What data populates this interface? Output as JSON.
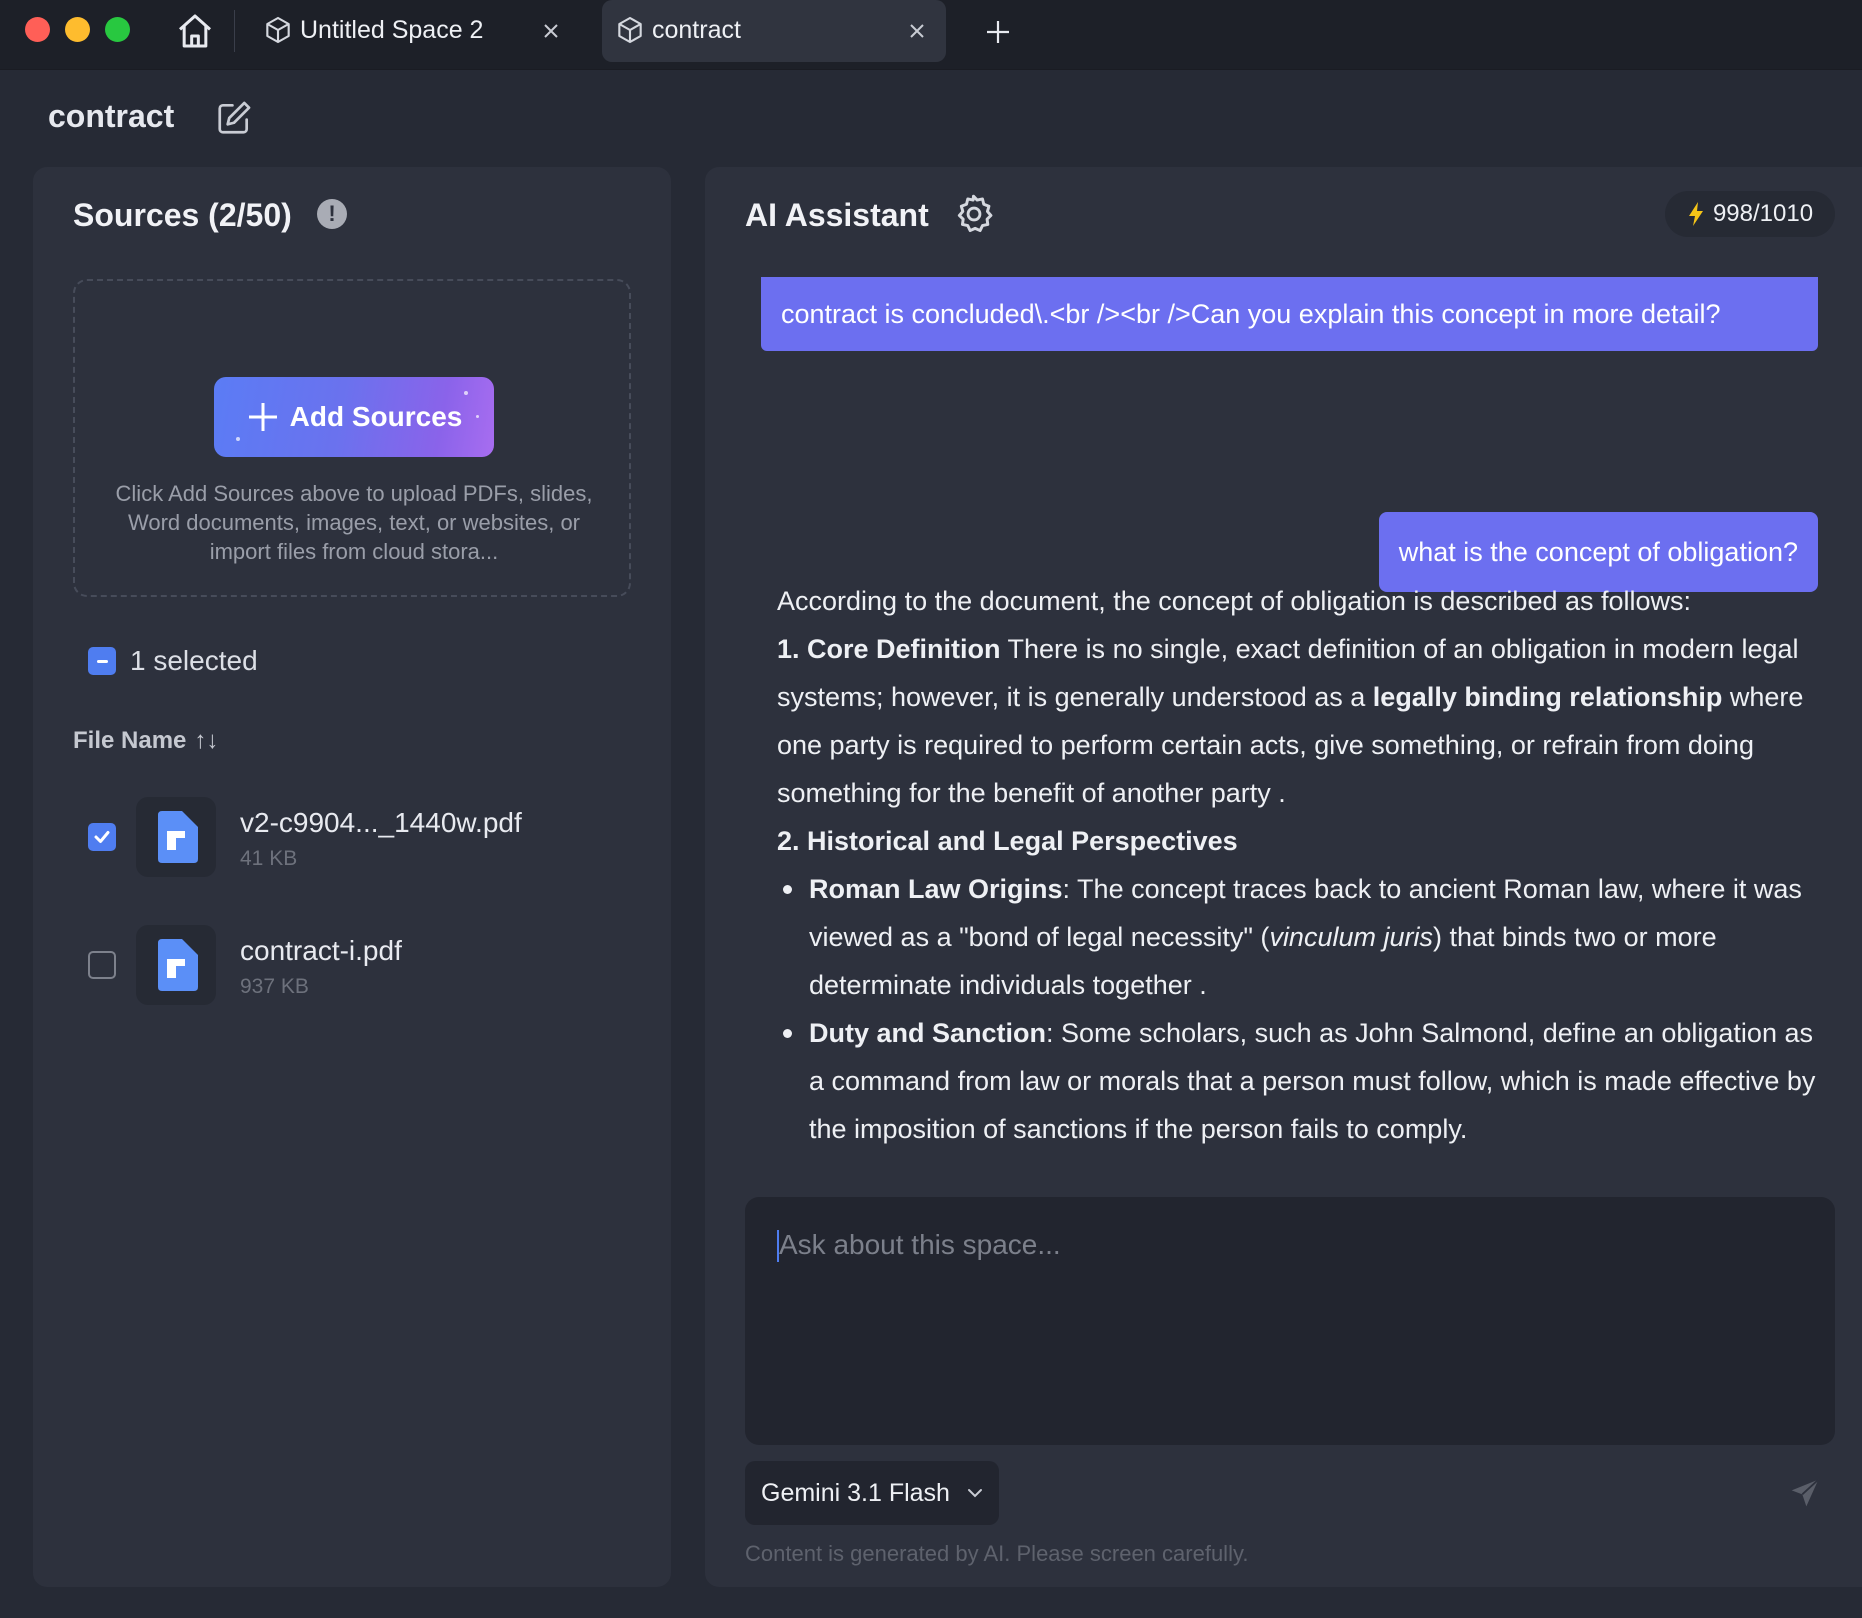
{
  "tabs": [
    {
      "label": "Untitled Space 2",
      "icon": "cube-icon",
      "active": false
    },
    {
      "label": "contract",
      "icon": "cube-icon",
      "active": true
    }
  ],
  "space": {
    "title": "contract"
  },
  "sources": {
    "title": "Sources (2/50)",
    "add_button_label": "Add Sources",
    "hint": "Click Add Sources above to upload PDFs, slides, Word documents, images, text, or websites, or import files from cloud stora...",
    "selected_label": "1 selected",
    "column_header": "File Name",
    "files": [
      {
        "name": "v2-c9904..._1440w.pdf",
        "size": "41 KB",
        "checked": true
      },
      {
        "name": "contract-i.pdf",
        "size": "937 KB",
        "checked": false
      }
    ]
  },
  "assistant": {
    "title": "AI Assistant",
    "credits": "998/1010",
    "messages": {
      "user_1_tail": "contract is concluded\\.<br /><br />Can you explain this concept in more detail?",
      "user_2": "what is the concept of obligation?",
      "answer": {
        "intro": "According to the document, the concept of obligation is described as follows:",
        "p1_heading": "1. Core Definition",
        "p1_text_a": " There is no single, exact definition of an obligation in modern legal systems; however, it is generally understood as a ",
        "p1_bold": "legally binding relationship",
        "p1_text_b": " where one party is required to perform certain acts, give something, or refrain from doing something for the benefit of another party .",
        "p2_heading": "2. Historical and Legal Perspectives",
        "b1_heading": "Roman Law Origins",
        "b1_text_a": ": The concept traces back to ancient Roman law, where it was viewed as a \"bond of legal necessity\" (",
        "b1_italic": "vinculum juris",
        "b1_text_b": ") that binds two or more determinate individuals together .",
        "b2_heading": "Duty and Sanction",
        "b2_text": ": Some scholars, such as John Salmond, define an obligation as a command from law or morals that a person must follow, which is made effective by the imposition of sanctions if the person fails to comply."
      }
    },
    "input_placeholder": "Ask about this space...",
    "model": "Gemini 3.1 Flash",
    "disclaimer": "Content is generated by AI. Please screen carefully."
  },
  "colors": {
    "accent": "#6c6ff0",
    "checkbox": "#4f7df0",
    "panel": "#2d313d",
    "background": "#262a35"
  }
}
